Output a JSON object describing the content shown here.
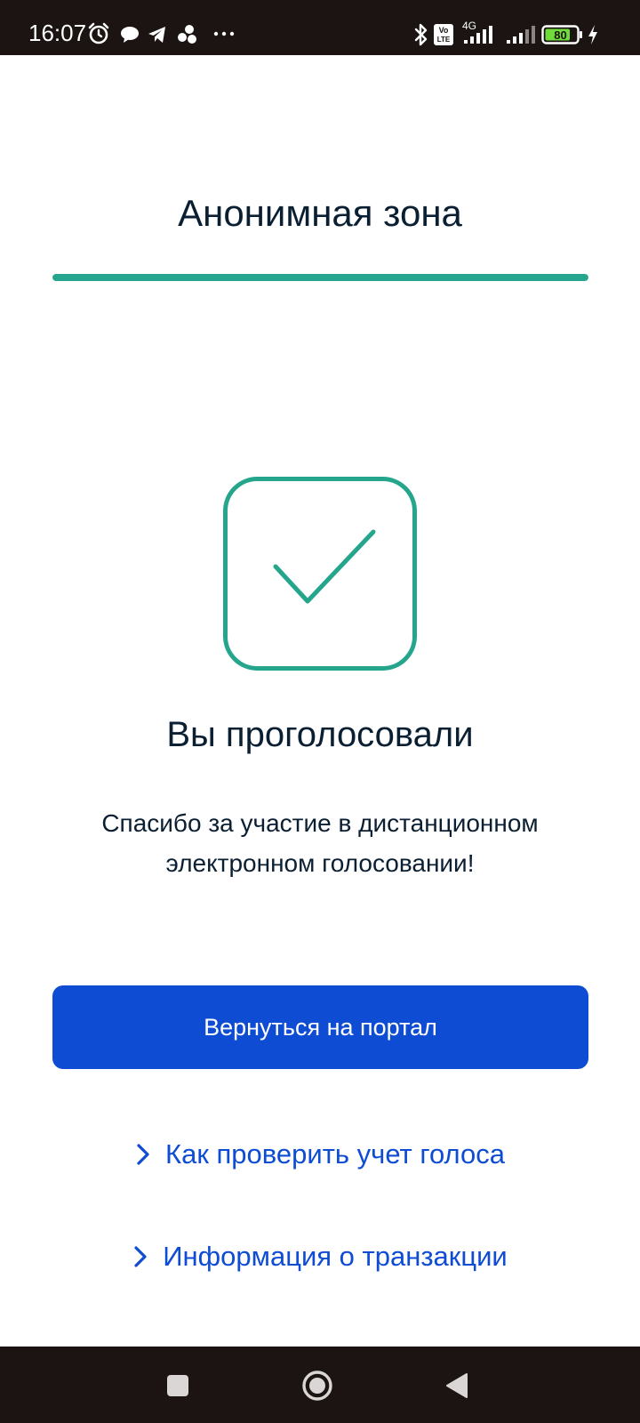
{
  "status_bar": {
    "time": "16:07",
    "network_type": "4G",
    "volte_label": "Vo LTE",
    "battery_percent": "80",
    "icons": [
      "alarm-icon",
      "chat-bubble-icon",
      "telegram-icon",
      "app-cluster-icon",
      "more-dots-icon",
      "bluetooth-icon",
      "volte-icon",
      "signal-icon",
      "signal-icon",
      "battery-icon",
      "charging-icon"
    ]
  },
  "header": {
    "title": "Анонимная зона",
    "progress": 1.0
  },
  "success": {
    "icon": "checkmark-icon",
    "title": "Вы проголосовали",
    "message": "Спасибо за участие в дистанционном электронном голосовании!"
  },
  "actions": {
    "return_button_label": "Вернуться на портал",
    "links": [
      {
        "label": "Как проверить учет голоса",
        "icon": "chevron-right-icon"
      },
      {
        "label": "Информация о транзакции",
        "icon": "chevron-right-icon"
      }
    ]
  },
  "nav_bar": {
    "buttons": [
      "recents-square-icon",
      "home-circle-icon",
      "back-triangle-icon"
    ]
  },
  "colors": {
    "accent_green": "#26a58d",
    "primary_blue": "#0d4cd3",
    "text_dark": "#0b1f33",
    "system_bar": "#1b1412",
    "battery_green": "#6fdc3a"
  }
}
